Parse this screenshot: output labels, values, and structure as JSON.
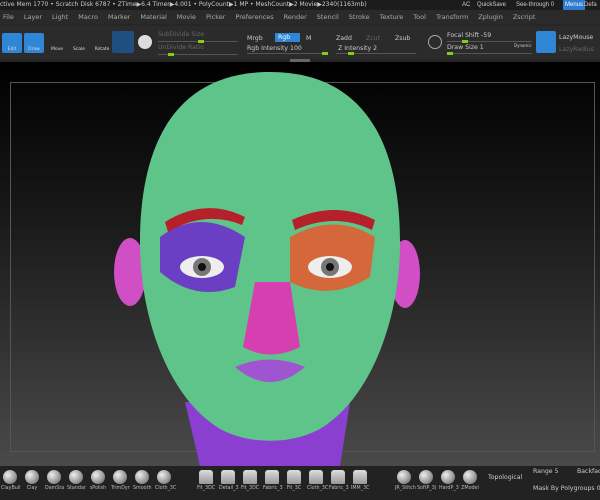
{
  "status": {
    "left": "ctive Mem 1770 • Scratch Disk 6787 • ZTime▶6.4 Timer▶4.001 • PolyCount▶1 MP • MeshCount▶2 Movie▶2340(1163mb)",
    "ac": "AC",
    "quicksave": "QuickSave",
    "see_through": "See-through 0",
    "menus": "Menus",
    "default": "Defa"
  },
  "menu": [
    "File",
    "Layer",
    "Light",
    "Macro",
    "Marker",
    "Material",
    "Movie",
    "Picker",
    "Preferences",
    "Render",
    "Stencil",
    "Stroke",
    "Texture",
    "Tool",
    "Transform",
    "Zplugin",
    "Zscript"
  ],
  "toolbar": {
    "edit": "Edit",
    "draw": "Draw",
    "move": "Move",
    "scale": "Scale",
    "rotate": "Rotate",
    "subdivide_size": "SubDivide Size",
    "undivide_ratio": "UnDivide Ratio",
    "mrgb": "Mrgb",
    "rgb": "Rgb",
    "m": "M",
    "rgb_intensity": "Rgb Intensity 100",
    "zadd": "Zadd",
    "zcut": "Zcut",
    "zsub": "Zsub",
    "z_intensity": "Z Intensity 2",
    "focal_shift": "Focal Shift -59",
    "draw_size": "Draw Size 1",
    "dynamic": "Dynamic",
    "lazymouse": "LazyMouse",
    "lazyradius": "LazyRadius"
  },
  "shelf": {
    "brushes": [
      "ClayBuil",
      "Clay",
      "DamSta",
      "Standar",
      "sPolish",
      "TrimDyr",
      "Smooth",
      "Cloth_3C"
    ],
    "cloth": [
      "Fit_3DC",
      "Detail_3",
      "Fit_3DC",
      "Fabric_3",
      "Fit_3C",
      "Cloth_3C",
      "Fabric_3",
      "IMM_3C"
    ],
    "tools": [
      "JR_Stitch",
      "SoftP_3(",
      "HardP_3",
      "ZModel"
    ],
    "topological": "Topological",
    "range": "Range 5",
    "backface": "Backfac",
    "mask_polygroups": "Mask By Polygroups 0"
  },
  "colors": {
    "accent": "#2f86d6",
    "slider": "#7fd012",
    "skin": "#5fc48a",
    "eyebrow": "#b5202a",
    "nose": "#d63fb0",
    "eye_left": "#6a3fc4",
    "eye_right": "#d4683a"
  }
}
